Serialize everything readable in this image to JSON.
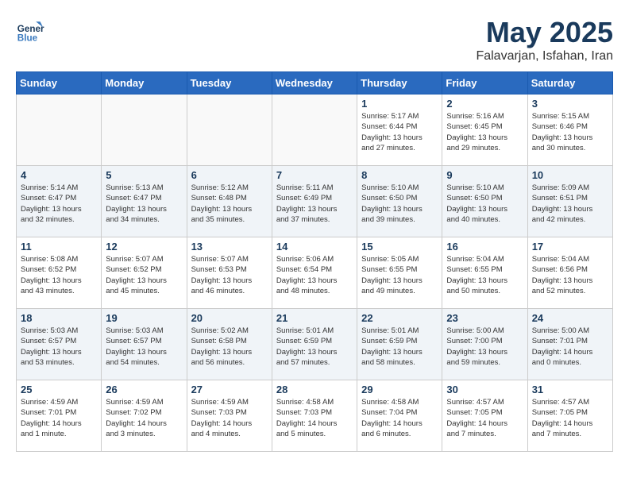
{
  "header": {
    "logo_line1": "General",
    "logo_line2": "Blue",
    "title": "May 2025",
    "subtitle": "Falavarjan, Isfahan, Iran"
  },
  "weekdays": [
    "Sunday",
    "Monday",
    "Tuesday",
    "Wednesday",
    "Thursday",
    "Friday",
    "Saturday"
  ],
  "weeks": [
    [
      {
        "day": "",
        "info": ""
      },
      {
        "day": "",
        "info": ""
      },
      {
        "day": "",
        "info": ""
      },
      {
        "day": "",
        "info": ""
      },
      {
        "day": "1",
        "info": "Sunrise: 5:17 AM\nSunset: 6:44 PM\nDaylight: 13 hours\nand 27 minutes."
      },
      {
        "day": "2",
        "info": "Sunrise: 5:16 AM\nSunset: 6:45 PM\nDaylight: 13 hours\nand 29 minutes."
      },
      {
        "day": "3",
        "info": "Sunrise: 5:15 AM\nSunset: 6:46 PM\nDaylight: 13 hours\nand 30 minutes."
      }
    ],
    [
      {
        "day": "4",
        "info": "Sunrise: 5:14 AM\nSunset: 6:47 PM\nDaylight: 13 hours\nand 32 minutes."
      },
      {
        "day": "5",
        "info": "Sunrise: 5:13 AM\nSunset: 6:47 PM\nDaylight: 13 hours\nand 34 minutes."
      },
      {
        "day": "6",
        "info": "Sunrise: 5:12 AM\nSunset: 6:48 PM\nDaylight: 13 hours\nand 35 minutes."
      },
      {
        "day": "7",
        "info": "Sunrise: 5:11 AM\nSunset: 6:49 PM\nDaylight: 13 hours\nand 37 minutes."
      },
      {
        "day": "8",
        "info": "Sunrise: 5:10 AM\nSunset: 6:50 PM\nDaylight: 13 hours\nand 39 minutes."
      },
      {
        "day": "9",
        "info": "Sunrise: 5:10 AM\nSunset: 6:50 PM\nDaylight: 13 hours\nand 40 minutes."
      },
      {
        "day": "10",
        "info": "Sunrise: 5:09 AM\nSunset: 6:51 PM\nDaylight: 13 hours\nand 42 minutes."
      }
    ],
    [
      {
        "day": "11",
        "info": "Sunrise: 5:08 AM\nSunset: 6:52 PM\nDaylight: 13 hours\nand 43 minutes."
      },
      {
        "day": "12",
        "info": "Sunrise: 5:07 AM\nSunset: 6:52 PM\nDaylight: 13 hours\nand 45 minutes."
      },
      {
        "day": "13",
        "info": "Sunrise: 5:07 AM\nSunset: 6:53 PM\nDaylight: 13 hours\nand 46 minutes."
      },
      {
        "day": "14",
        "info": "Sunrise: 5:06 AM\nSunset: 6:54 PM\nDaylight: 13 hours\nand 48 minutes."
      },
      {
        "day": "15",
        "info": "Sunrise: 5:05 AM\nSunset: 6:55 PM\nDaylight: 13 hours\nand 49 minutes."
      },
      {
        "day": "16",
        "info": "Sunrise: 5:04 AM\nSunset: 6:55 PM\nDaylight: 13 hours\nand 50 minutes."
      },
      {
        "day": "17",
        "info": "Sunrise: 5:04 AM\nSunset: 6:56 PM\nDaylight: 13 hours\nand 52 minutes."
      }
    ],
    [
      {
        "day": "18",
        "info": "Sunrise: 5:03 AM\nSunset: 6:57 PM\nDaylight: 13 hours\nand 53 minutes."
      },
      {
        "day": "19",
        "info": "Sunrise: 5:03 AM\nSunset: 6:57 PM\nDaylight: 13 hours\nand 54 minutes."
      },
      {
        "day": "20",
        "info": "Sunrise: 5:02 AM\nSunset: 6:58 PM\nDaylight: 13 hours\nand 56 minutes."
      },
      {
        "day": "21",
        "info": "Sunrise: 5:01 AM\nSunset: 6:59 PM\nDaylight: 13 hours\nand 57 minutes."
      },
      {
        "day": "22",
        "info": "Sunrise: 5:01 AM\nSunset: 6:59 PM\nDaylight: 13 hours\nand 58 minutes."
      },
      {
        "day": "23",
        "info": "Sunrise: 5:00 AM\nSunset: 7:00 PM\nDaylight: 13 hours\nand 59 minutes."
      },
      {
        "day": "24",
        "info": "Sunrise: 5:00 AM\nSunset: 7:01 PM\nDaylight: 14 hours\nand 0 minutes."
      }
    ],
    [
      {
        "day": "25",
        "info": "Sunrise: 4:59 AM\nSunset: 7:01 PM\nDaylight: 14 hours\nand 1 minute."
      },
      {
        "day": "26",
        "info": "Sunrise: 4:59 AM\nSunset: 7:02 PM\nDaylight: 14 hours\nand 3 minutes."
      },
      {
        "day": "27",
        "info": "Sunrise: 4:59 AM\nSunset: 7:03 PM\nDaylight: 14 hours\nand 4 minutes."
      },
      {
        "day": "28",
        "info": "Sunrise: 4:58 AM\nSunset: 7:03 PM\nDaylight: 14 hours\nand 5 minutes."
      },
      {
        "day": "29",
        "info": "Sunrise: 4:58 AM\nSunset: 7:04 PM\nDaylight: 14 hours\nand 6 minutes."
      },
      {
        "day": "30",
        "info": "Sunrise: 4:57 AM\nSunset: 7:05 PM\nDaylight: 14 hours\nand 7 minutes."
      },
      {
        "day": "31",
        "info": "Sunrise: 4:57 AM\nSunset: 7:05 PM\nDaylight: 14 hours\nand 7 minutes."
      }
    ]
  ]
}
